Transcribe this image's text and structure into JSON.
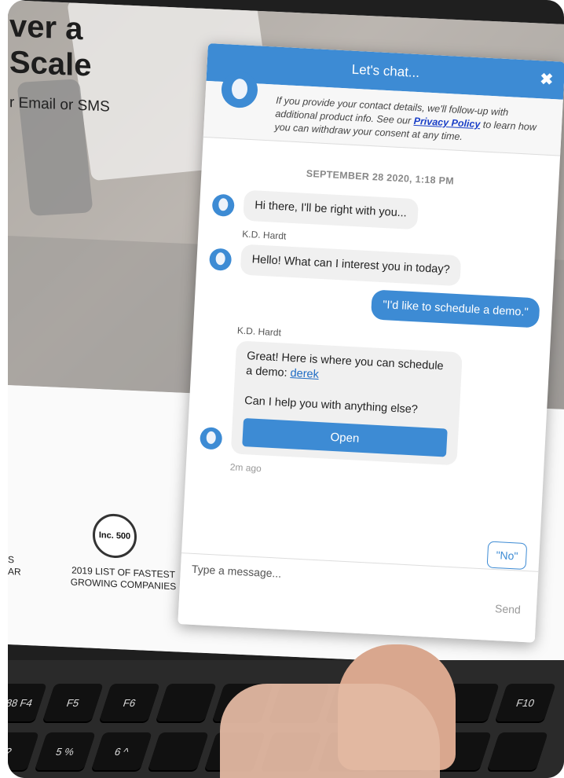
{
  "website": {
    "headline_line1": "ver a",
    "headline_line2": "Scale",
    "subheadline": "r Email or SMS",
    "award_left_fragment": "S\nAR",
    "award_badge": "Inc. 500",
    "award_text": "2019 LIST OF FASTEST GROWING COMPANIES"
  },
  "chat": {
    "title": "Let's chat...",
    "close_label": "✖",
    "consent": {
      "text_before": "If you provide your contact details, we'll follow-up with additional product info. See our ",
      "link_label": "Privacy Policy",
      "text_after": " to learn how you can withdraw your consent at any time."
    },
    "date_label": "SEPTEMBER 28 2020, 1:18 PM",
    "messages": [
      {
        "text": "Hi there, I'll be right with you..."
      },
      {
        "sender": "K.D. Hardt",
        "text": "Hello! What can I interest you in today?"
      },
      {
        "user_text": "\"I'd like to schedule a demo.\""
      },
      {
        "sender": "K.D. Hardt",
        "text_before_link": "Great! Here is where you can schedule a demo: ",
        "link_label": "derek",
        "text_after": "Can I help you with anything else?",
        "button_label": "Open",
        "timestamp": "2m ago"
      }
    ],
    "quick_reply": "\"No\"",
    "input_placeholder": "Type a message...",
    "send_label": "Send"
  },
  "keyboard": {
    "row1": [
      "888 F4",
      "F5",
      "F6",
      "",
      "",
      "",
      "",
      "",
      "",
      "F10"
    ],
    "row2": [
      "?",
      "5 %",
      "6 ^",
      "",
      "",
      "",
      "",
      "",
      "",
      ""
    ]
  }
}
